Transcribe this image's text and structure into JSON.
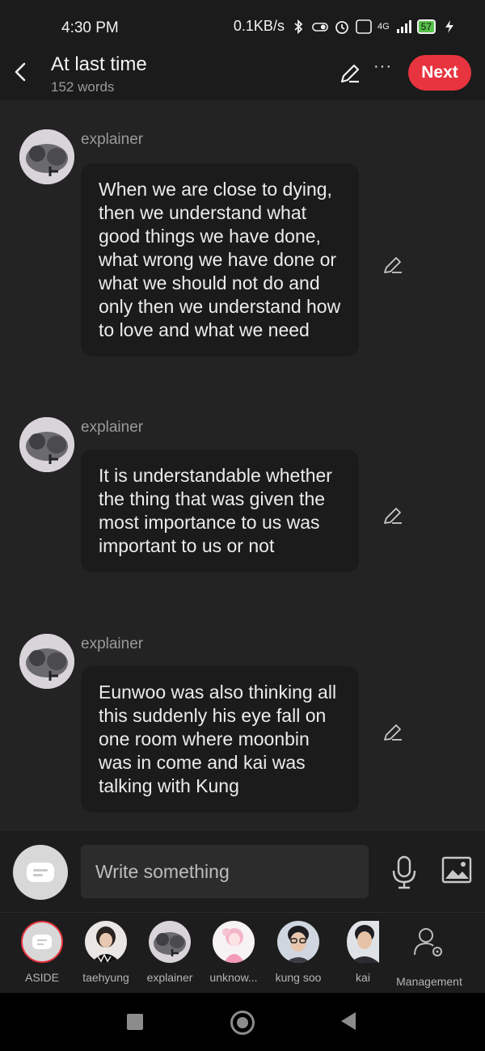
{
  "status_bar": {
    "time": "4:30 PM",
    "net_speed": "0.1KB/s",
    "network": "4G",
    "battery": "57"
  },
  "header": {
    "title": "At last time",
    "subtitle": "152 words",
    "next_label": "Next"
  },
  "messages": [
    {
      "sender": "explainer",
      "text": "When we are close to dying, then we understand what good things we have done, what wrong we have done or what we should not do and only then we understand how to love and what we need"
    },
    {
      "sender": "explainer",
      "text": "It is understandable whether the thing that was given the most importance to us was important to us or not"
    },
    {
      "sender": "explainer",
      "text": "Eunwoo was also thinking all this suddenly his eye fall on one room where moonbin was in come and kai was talking with Kung"
    }
  ],
  "composer": {
    "placeholder": "Write something"
  },
  "roles": [
    {
      "label": "ASIDE"
    },
    {
      "label": "taehyung"
    },
    {
      "label": "explainer"
    },
    {
      "label": "unknow..."
    },
    {
      "label": "kung soo"
    },
    {
      "label": "kai"
    },
    {
      "label": "Management"
    }
  ],
  "colors": {
    "accent": "#e8343f",
    "background": "#232323",
    "bubble": "#1b1b1b"
  }
}
